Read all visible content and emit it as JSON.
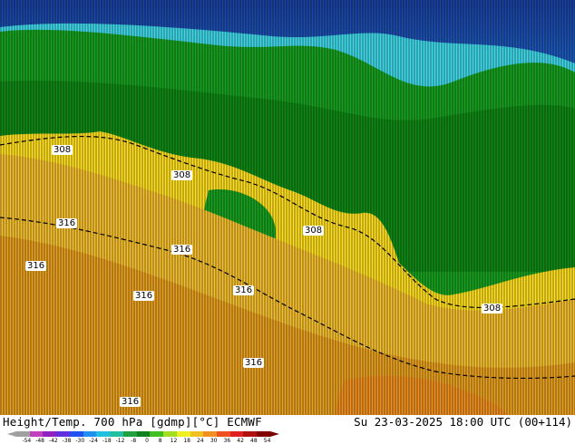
{
  "map": {
    "contour_labels": [
      "308",
      "308",
      "316",
      "316",
      "316",
      "316",
      "308",
      "316",
      "308",
      "316",
      "316"
    ],
    "colors": {
      "hot": "#e8a020",
      "warm": "#f5c030",
      "yellow": "#ffe020",
      "green_dark": "#0a7a10",
      "green": "#18a020",
      "green_light": "#30c030",
      "teal": "#20b8b8",
      "cyan": "#40e0f0",
      "blue": "#2080e0",
      "blue_dark": "#1a40a0"
    }
  },
  "footer": {
    "title": "Height/Temp. 700 hPa [gdmp][°C] ECMWF",
    "date": "Su 23-03-2025 18:00 UTC (00+114)"
  },
  "colorbar": {
    "ticks": [
      "-54",
      "-48",
      "-42",
      "-38",
      "-30",
      "-24",
      "-18",
      "-12",
      "-8",
      "0",
      "8",
      "12",
      "18",
      "24",
      "30",
      "36",
      "42",
      "48",
      "54"
    ],
    "colors": [
      "#a0a0a0",
      "#c040c0",
      "#9020c0",
      "#6030e0",
      "#2050f0",
      "#2090f0",
      "#20c0e0",
      "#20c0a0",
      "#20a040",
      "#108020",
      "#40c020",
      "#a0e020",
      "#f0f020",
      "#f0c020",
      "#f09020",
      "#f05020",
      "#e02020",
      "#b01010",
      "#800000"
    ]
  }
}
